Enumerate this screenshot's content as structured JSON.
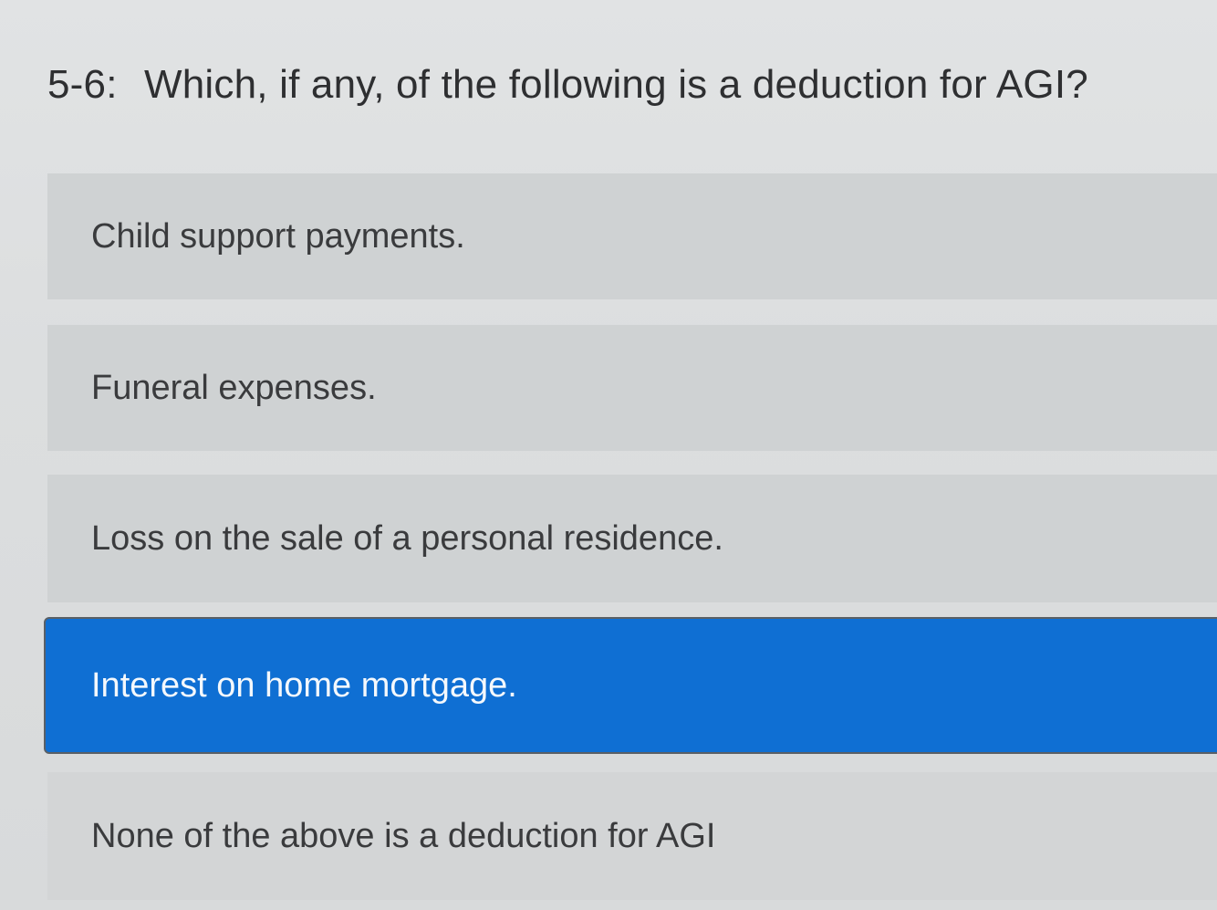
{
  "question": {
    "number": "5-6:",
    "text": "Which, if any, of the following is a deduction for AGI?"
  },
  "options": [
    {
      "label": "Child support payments.",
      "selected": false
    },
    {
      "label": "Funeral expenses.",
      "selected": false
    },
    {
      "label": "Loss on the sale of a personal residence.",
      "selected": false
    },
    {
      "label": "Interest on home mortgage.",
      "selected": true
    },
    {
      "label": "None of the above is a deduction for AGI",
      "selected": false
    }
  ],
  "colors": {
    "selected_background": "#0f6fd3",
    "selected_text": "#f4f8fc",
    "option_background": "#cfd2d3",
    "page_background": "#dcdfe0",
    "text": "#2e2f31"
  }
}
